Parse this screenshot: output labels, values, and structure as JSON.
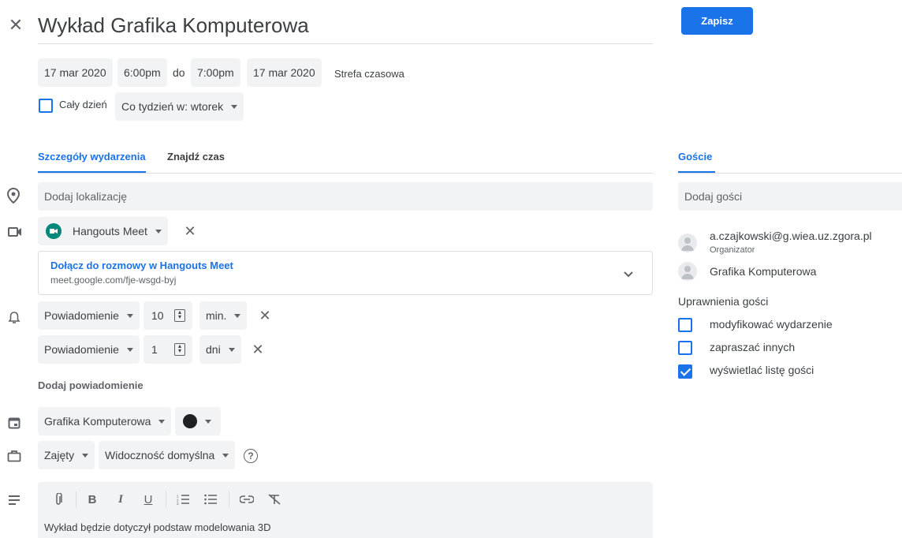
{
  "header": {
    "title": "Wykład Grafika Komputerowa",
    "save_label": "Zapisz"
  },
  "datetime": {
    "start_date": "17 mar 2020",
    "start_time": "6:00pm",
    "to_label": "do",
    "end_time": "7:00pm",
    "end_date": "17 mar 2020",
    "timezone_label": "Strefa czasowa",
    "all_day_label": "Cały dzień",
    "recurrence": "Co tydzień w: wtorek"
  },
  "tabs": {
    "details": "Szczegóły wydarzenia",
    "find_time": "Znajdź czas",
    "guests": "Goście"
  },
  "location": {
    "placeholder": "Dodaj lokalizację"
  },
  "conference": {
    "provider": "Hangouts Meet",
    "join_label": "Dołącz do rozmowy w Hangouts Meet",
    "link": "meet.google.com/fje-wsgd-byj"
  },
  "notifications": [
    {
      "type": "Powiadomienie",
      "value": "10",
      "unit": "min."
    },
    {
      "type": "Powiadomienie",
      "value": "1",
      "unit": "dni"
    }
  ],
  "add_notification_label": "Dodaj powiadomienie",
  "calendar": {
    "name": "Grafika Komputerowa",
    "color": "#202124"
  },
  "availability": {
    "status": "Zajęty",
    "visibility": "Widoczność domyślna"
  },
  "description": {
    "text": "Wykład będzie dotyczył podstaw modelowania 3D"
  },
  "guests": {
    "add_placeholder": "Dodaj gości",
    "list": [
      {
        "name": "a.czajkowski@g.wiea.uz.zgora.pl",
        "role": "Organizator"
      },
      {
        "name": "Grafika Komputerowa",
        "role": ""
      }
    ],
    "permissions_title": "Uprawnienia gości",
    "permissions": [
      {
        "label": "modyfikować wydarzenie",
        "checked": false
      },
      {
        "label": "zapraszać innych",
        "checked": false
      },
      {
        "label": "wyświetlać listę gości",
        "checked": true
      }
    ]
  },
  "colors": {
    "accent": "#1a73e8",
    "chip_bg": "#f1f3f4",
    "meet_green": "#00897b"
  }
}
